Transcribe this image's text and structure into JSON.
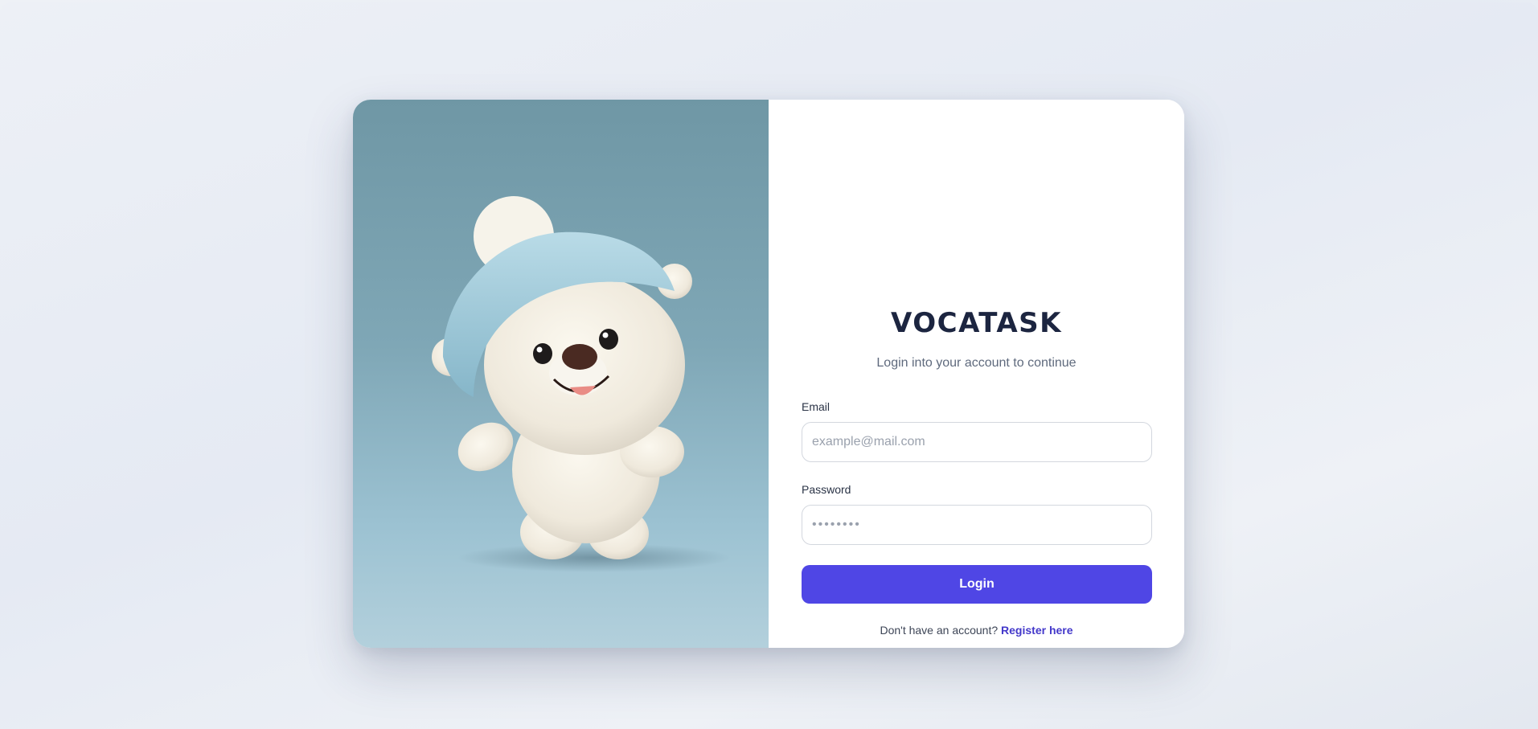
{
  "brand": {
    "name": "VOCATASK"
  },
  "login": {
    "subtitle": "Login into your account to continue",
    "email_label": "Email",
    "email_placeholder": "example@mail.com",
    "password_label": "Password",
    "password_placeholder": "••••••••",
    "submit_label": "Login",
    "register_prompt": "Don't have an account?",
    "register_link": "Register here"
  },
  "colors": {
    "accent": "#4f46e5",
    "link": "#4338ca",
    "heading": "#1c2540",
    "illustration_bg": "#7fa7b6"
  },
  "illustration": {
    "subject": "bear-mascot-with-knit-hat"
  }
}
